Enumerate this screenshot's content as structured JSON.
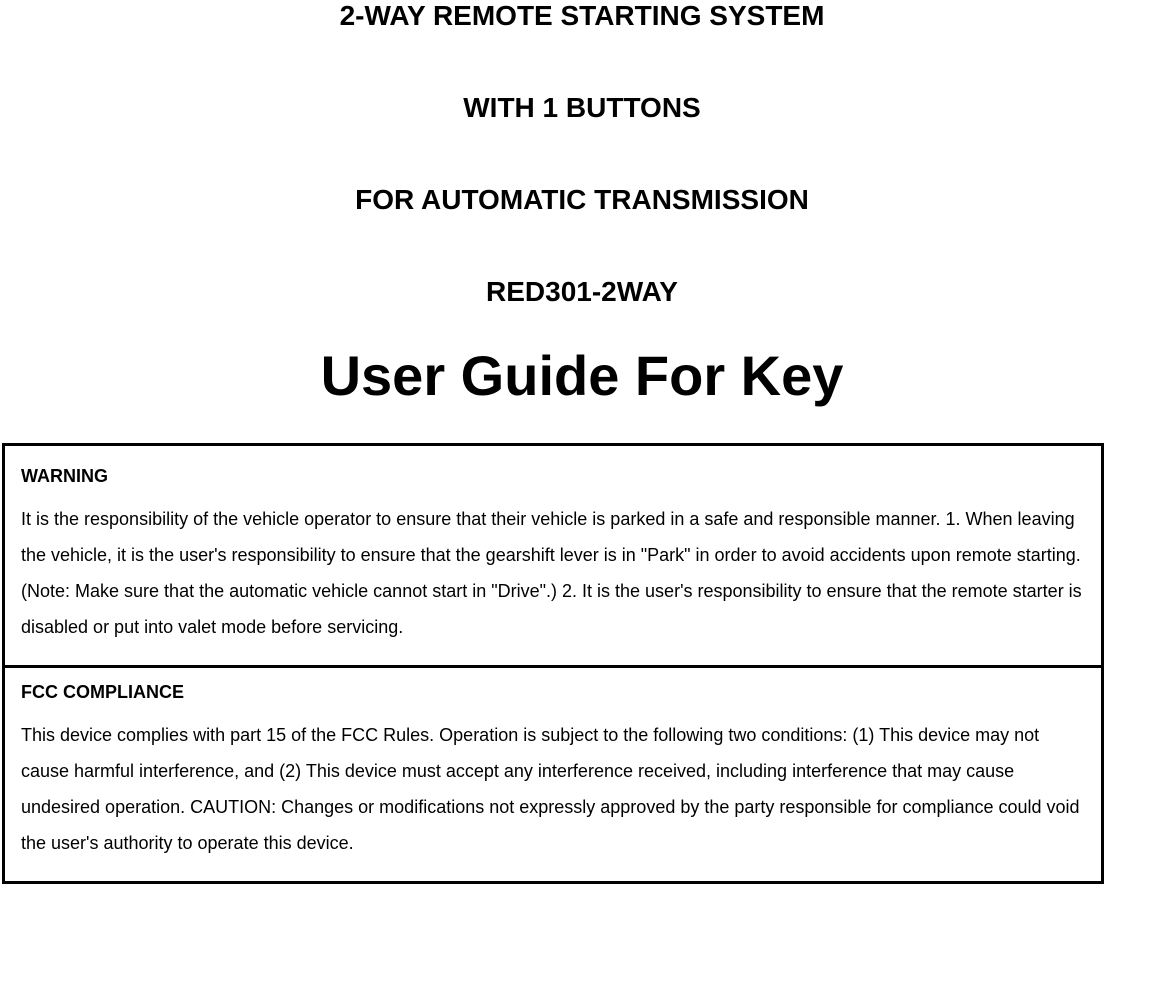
{
  "header": {
    "line1": "2-WAY REMOTE STARTING SYSTEM",
    "line2": "WITH 1 BUTTONS",
    "line3": "FOR AUTOMATIC TRANSMISSION",
    "line4": "RED301-2WAY",
    "mainTitle": "User Guide For Key"
  },
  "warning": {
    "heading": "WARNING",
    "text": "It is the responsibility of the vehicle operator to ensure that their vehicle is parked in a safe and responsible manner. 1. When leaving the vehicle, it is the user's responsibility to ensure that the gearshift lever is in \"Park\" in order to avoid accidents upon remote starting. (Note: Make sure that the automatic vehicle cannot start in \"Drive\".) 2. It is the user's responsibility to ensure that the remote starter is disabled or put into valet mode before servicing."
  },
  "fcc": {
    "heading": "FCC COMPLIANCE",
    "text": "This device complies with part 15 of the FCC Rules. Operation is subject to the following two conditions: (1) This device may not cause harmful interference, and (2) This device must accept any interference received, including interference that may cause undesired operation. CAUTION: Changes or modifications not expressly approved by the party responsible for compliance could void the user's authority to operate this device."
  }
}
